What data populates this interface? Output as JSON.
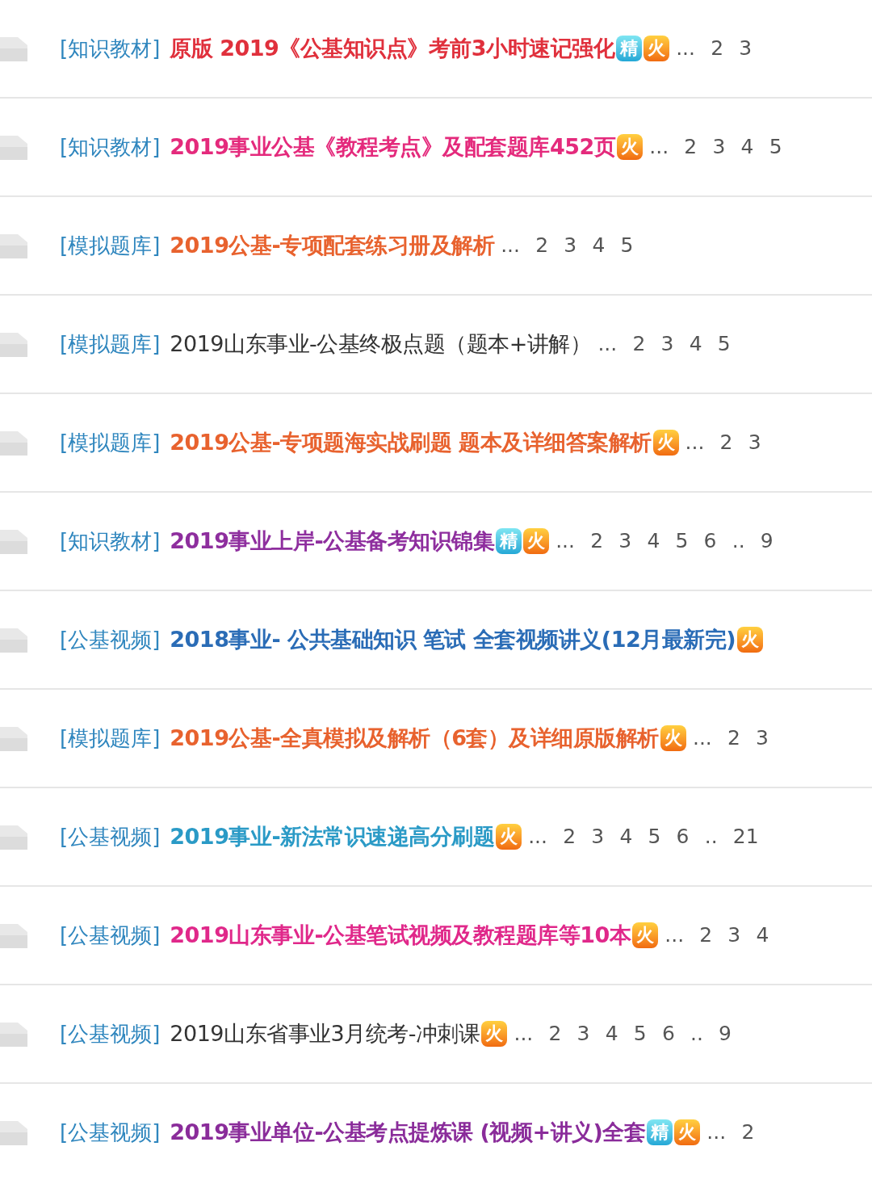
{
  "rows": [
    {
      "category": "[知识教材]",
      "title": "原版 2019《公基知识点》考前3小时速记强化",
      "bold": true,
      "color": "#e0303c",
      "badges": [
        {
          "kind": "featured",
          "text": "精"
        },
        {
          "kind": "hot",
          "text": "火"
        }
      ],
      "pages": "... 2 3"
    },
    {
      "category": "[知识教材]",
      "title": "2019事业公基《教程考点》及配套题库452页",
      "bold": true,
      "color": "#e42a7c",
      "badges": [
        {
          "kind": "hot",
          "text": "火"
        }
      ],
      "pages": "... 2 3 4 5"
    },
    {
      "category": "[模拟题库]",
      "title": "2019公基-专项配套练习册及解析",
      "bold": true,
      "color": "#e8622e",
      "badges": [],
      "pages": "... 2 3 4 5"
    },
    {
      "category": "[模拟题库]",
      "title": "2019山东事业-公基终极点题（题本+讲解）",
      "bold": false,
      "color": "#333333",
      "badges": [],
      "pages": "... 2 3 4 5"
    },
    {
      "category": "[模拟题库]",
      "title": "2019公基-专项题海实战刷题 题本及详细答案解析",
      "bold": true,
      "color": "#e8622e",
      "badges": [
        {
          "kind": "hot",
          "text": "火"
        }
      ],
      "pages": "... 2 3"
    },
    {
      "category": "[知识教材]",
      "title": "2019事业上岸-公基备考知识锦集",
      "bold": true,
      "color": "#8e2e9e",
      "badges": [
        {
          "kind": "featured",
          "text": "精"
        },
        {
          "kind": "hot",
          "text": "火"
        }
      ],
      "pages": "... 2 3 4 5 6 .. 9"
    },
    {
      "category": "[公基视频]",
      "title": "2018事业- 公共基础知识 笔试 全套视频讲义(12月最新完)",
      "bold": true,
      "color": "#2a6cb6",
      "badges": [
        {
          "kind": "hot",
          "text": "火"
        }
      ],
      "pages": ""
    },
    {
      "category": "[模拟题库]",
      "title": "2019公基-全真模拟及解析（6套）及详细原版解析",
      "bold": true,
      "color": "#e8622e",
      "badges": [
        {
          "kind": "hot",
          "text": "火"
        }
      ],
      "pages": "... 2 3"
    },
    {
      "category": "[公基视频]",
      "title": "2019事业-新法常识速递高分刷题",
      "bold": true,
      "color": "#2a9ac6",
      "badges": [
        {
          "kind": "hot",
          "text": "火"
        }
      ],
      "pages": "... 2 3 4 5 6 .. 21"
    },
    {
      "category": "[公基视频]",
      "title": "2019山东事业-公基笔试视频及教程题库等10本",
      "bold": true,
      "color": "#e0288a",
      "badges": [
        {
          "kind": "hot",
          "text": "火"
        }
      ],
      "pages": "... 2 3 4"
    },
    {
      "category": "[公基视频]",
      "title": "2019山东省事业3月统考-冲刺课",
      "bold": false,
      "color": "#333333",
      "badges": [
        {
          "kind": "hot",
          "text": "火"
        }
      ],
      "pages": "... 2 3 4 5 6 .. 9"
    },
    {
      "category": "[公基视频]",
      "title": "2019事业单位-公基考点提炼课 (视频+讲义)全套",
      "bold": true,
      "color": "#8a2c9a",
      "badges": [
        {
          "kind": "featured",
          "text": "精"
        },
        {
          "kind": "hot",
          "text": "火"
        }
      ],
      "pages": "... 2"
    }
  ]
}
